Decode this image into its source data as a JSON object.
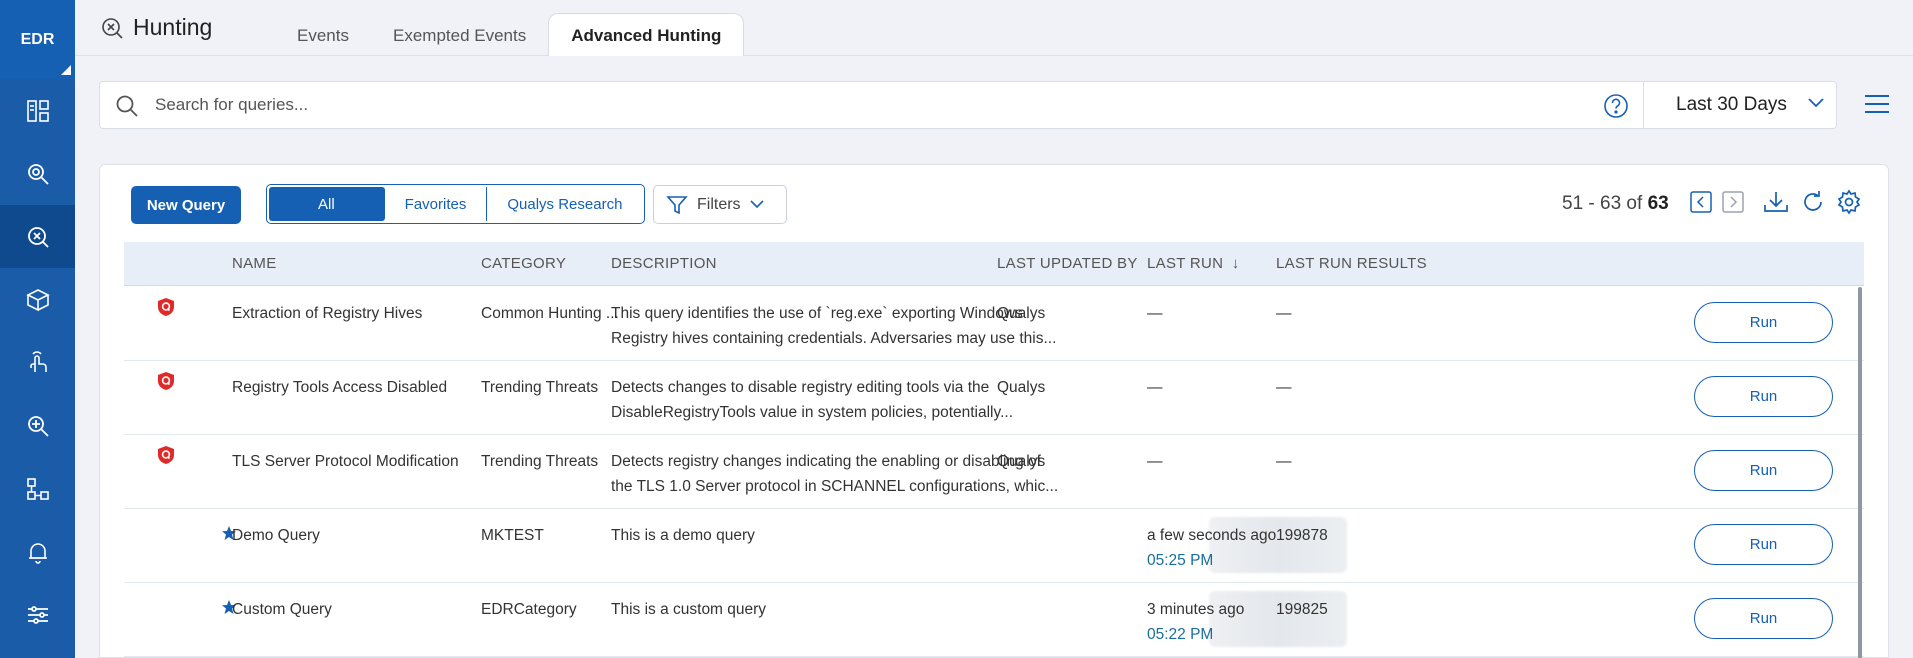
{
  "sidebar": {
    "brand": "EDR",
    "items": [
      {
        "icon": "dashboard-icon"
      },
      {
        "icon": "investigate-icon"
      },
      {
        "icon": "hunting-icon",
        "active": true
      },
      {
        "icon": "assets-icon"
      },
      {
        "icon": "response-icon"
      },
      {
        "icon": "threat-icon"
      },
      {
        "icon": "workflow-icon"
      },
      {
        "icon": "notifications-icon"
      },
      {
        "icon": "settings-icon"
      }
    ]
  },
  "header": {
    "title": "Hunting",
    "tabs": [
      {
        "label": "Events"
      },
      {
        "label": "Exempted Events"
      },
      {
        "label": "Advanced Hunting",
        "active": true
      }
    ]
  },
  "search": {
    "placeholder": "Search for queries...",
    "value": ""
  },
  "date_filter": {
    "selected": "Last 30 Days"
  },
  "toolbar": {
    "new_query": "New Query",
    "segments": [
      "All",
      "Favorites",
      "Qualys Research"
    ],
    "selected_segment": "All",
    "filters": "Filters",
    "pager_range": "51 - 63 of",
    "pager_total": "63"
  },
  "table": {
    "columns": {
      "name": "NAME",
      "category": "CATEGORY",
      "description": "DESCRIPTION",
      "updated_by": "LAST UPDATED BY",
      "last_run": "LAST RUN",
      "last_run_results": "LAST RUN RESULTS"
    },
    "sort_indicator": "↓",
    "run_label": "Run",
    "rows": [
      {
        "marker": "qualys-shield",
        "name": "Extraction of Registry Hives",
        "category": "Common Hunting ...",
        "description_line1": "This query identifies the use of `reg.exe` exporting Windows",
        "description_line2": "Registry hives containing credentials. Adversaries may use this...",
        "updated_by": "Qualys",
        "last_run": "—",
        "last_run_time": "",
        "results": "—"
      },
      {
        "marker": "qualys-shield",
        "name": "Registry Tools Access Disabled",
        "category": "Trending Threats",
        "description_line1": "Detects changes to disable registry editing tools via the",
        "description_line2": "DisableRegistryTools value in system policies, potentially...",
        "updated_by": "Qualys",
        "last_run": "—",
        "last_run_time": "",
        "results": "—"
      },
      {
        "marker": "qualys-shield",
        "name": "TLS Server Protocol Modification",
        "category": "Trending Threats",
        "description_line1": "Detects registry changes indicating the enabling or disabling of",
        "description_line2": "the TLS 1.0 Server protocol in SCHANNEL configurations, whic...",
        "updated_by": "Qualys",
        "last_run": "—",
        "last_run_time": "",
        "results": "—"
      },
      {
        "marker": "favorite-star",
        "name": "Demo Query",
        "category": "MKTEST",
        "description_line1": "This is a demo query",
        "description_line2": "",
        "updated_by": "",
        "last_run": "a few seconds ago",
        "last_run_time": "05:25 PM",
        "results": "199878"
      },
      {
        "marker": "favorite-star",
        "name": "Custom Query",
        "category": "EDRCategory",
        "description_line1": "This is a custom query",
        "description_line2": "",
        "updated_by": "",
        "last_run": "3 minutes ago",
        "last_run_time": "05:22 PM",
        "results": "199825"
      }
    ]
  },
  "colors": {
    "sidebar": "#1a5ca7",
    "accent": "#1560b3",
    "shield_red": "#e02a2a"
  }
}
